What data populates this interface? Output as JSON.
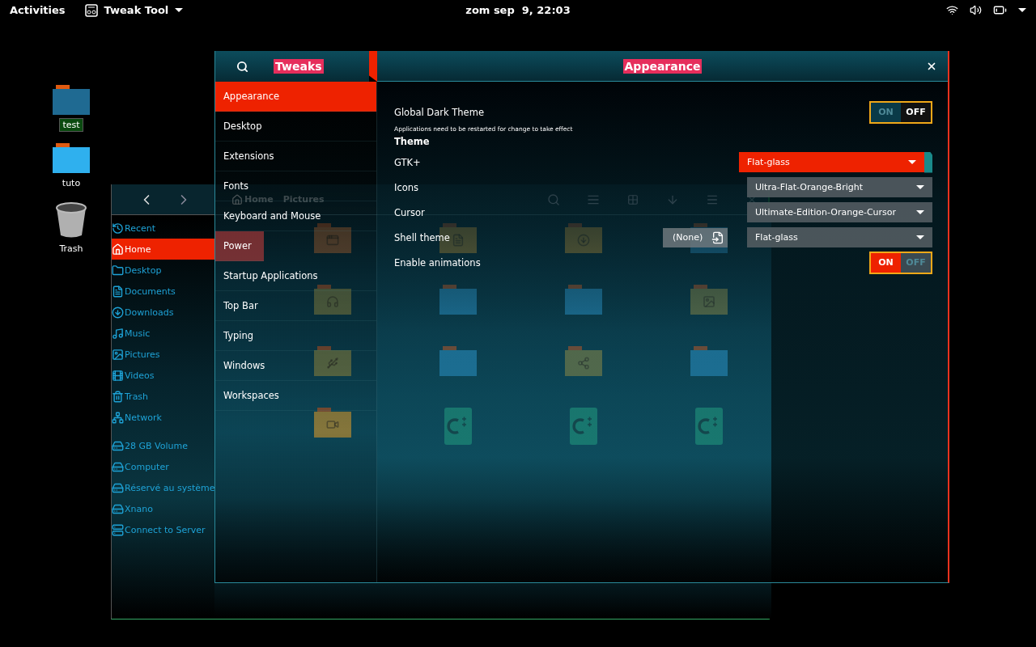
{
  "top_bar": {
    "activities": "Activities",
    "app_menu": "Tweak Tool",
    "clock": "zom sep  9, 22:03"
  },
  "desktop_icons": [
    {
      "label": "test",
      "kind": "folder",
      "color": "#1f6a92",
      "selected": true
    },
    {
      "label": "tuto",
      "kind": "folder",
      "color": "#2fb0ee",
      "selected": false
    },
    {
      "label": "Trash",
      "kind": "trash",
      "selected": false
    }
  ],
  "file_manager": {
    "path": [
      {
        "label": "Home",
        "kind": "home"
      },
      {
        "label": "Pictures",
        "kind": "plain"
      }
    ],
    "places": [
      {
        "label": "Recent",
        "kind": "recent",
        "selected": false
      },
      {
        "label": "Home",
        "kind": "home",
        "selected": true
      },
      {
        "label": "Desktop",
        "kind": "desktop",
        "selected": false
      },
      {
        "label": "Documents",
        "kind": "documents",
        "selected": false
      },
      {
        "label": "Downloads",
        "kind": "downloads",
        "selected": false
      },
      {
        "label": "Music",
        "kind": "music",
        "selected": false
      },
      {
        "label": "Pictures",
        "kind": "pictures",
        "selected": false
      },
      {
        "label": "Videos",
        "kind": "videos",
        "selected": false
      },
      {
        "label": "Trash",
        "kind": "trash",
        "selected": false
      },
      {
        "label": "Network",
        "kind": "network",
        "selected": false
      }
    ],
    "devices": [
      {
        "label": "28 GB Volume",
        "kind": "drive",
        "selected": false
      },
      {
        "label": "Computer",
        "kind": "drive",
        "selected": false
      },
      {
        "label": "Réservé au système",
        "kind": "drive",
        "selected": false
      },
      {
        "label": "Xnano",
        "kind": "drive",
        "selected": false
      },
      {
        "label": "Connect to Server",
        "kind": "server",
        "selected": false
      }
    ],
    "items": [
      {
        "kind": "desktop"
      },
      {
        "kind": "document"
      },
      {
        "kind": "download"
      },
      {
        "kind": "plain"
      },
      {
        "kind": "music"
      },
      {
        "kind": "plain"
      },
      {
        "kind": "plain"
      },
      {
        "kind": "pictures"
      },
      {
        "kind": "usb"
      },
      {
        "kind": "plain"
      },
      {
        "kind": "share"
      },
      {
        "kind": "plain"
      },
      {
        "kind": "video"
      },
      {
        "kind": "cpp"
      },
      {
        "kind": "cpp"
      },
      {
        "kind": "cpp"
      }
    ]
  },
  "tweaks": {
    "title": "Tweaks",
    "page_title": "Appearance",
    "sidebar": [
      {
        "label": "Appearance",
        "selected": true,
        "highlighted": false
      },
      {
        "label": "Desktop",
        "selected": false,
        "highlighted": false
      },
      {
        "label": "Extensions",
        "selected": false,
        "highlighted": false
      },
      {
        "label": "Fonts",
        "selected": false,
        "highlighted": false
      },
      {
        "label": "Keyboard and Mouse",
        "selected": false,
        "highlighted": false
      },
      {
        "label": "Power",
        "selected": false,
        "highlighted": true
      },
      {
        "label": "Startup Applications",
        "selected": false,
        "highlighted": false
      },
      {
        "label": "Top Bar",
        "selected": false,
        "highlighted": false
      },
      {
        "label": "Typing",
        "selected": false,
        "highlighted": false
      },
      {
        "label": "Windows",
        "selected": false,
        "highlighted": false
      },
      {
        "label": "Workspaces",
        "selected": false,
        "highlighted": false
      }
    ],
    "settings": [
      {
        "kind": "switch",
        "label": "Global Dark Theme",
        "on": false,
        "on_label": "ON",
        "off_label": "OFF"
      },
      {
        "kind": "note",
        "label": "Applications need to be restarted for change to take effect"
      },
      {
        "kind": "heading",
        "label": "Theme"
      },
      {
        "kind": "dropdown",
        "label": "GTK+",
        "value": "Flat-glass",
        "focused": true
      },
      {
        "kind": "dropdown",
        "label": "Icons",
        "value": "Ultra-Flat-Orange-Bright",
        "focused": false
      },
      {
        "kind": "dropdown",
        "label": "Cursor",
        "value": "Ultimate-Edition-Orange-Cursor",
        "focused": false
      },
      {
        "kind": "shell",
        "label": "Shell theme",
        "value": "Flat-glass",
        "file_button": "(None)",
        "focused": false
      },
      {
        "kind": "switch",
        "label": "Enable animations",
        "on": true,
        "on_label": "ON",
        "off_label": "OFF"
      }
    ]
  }
}
